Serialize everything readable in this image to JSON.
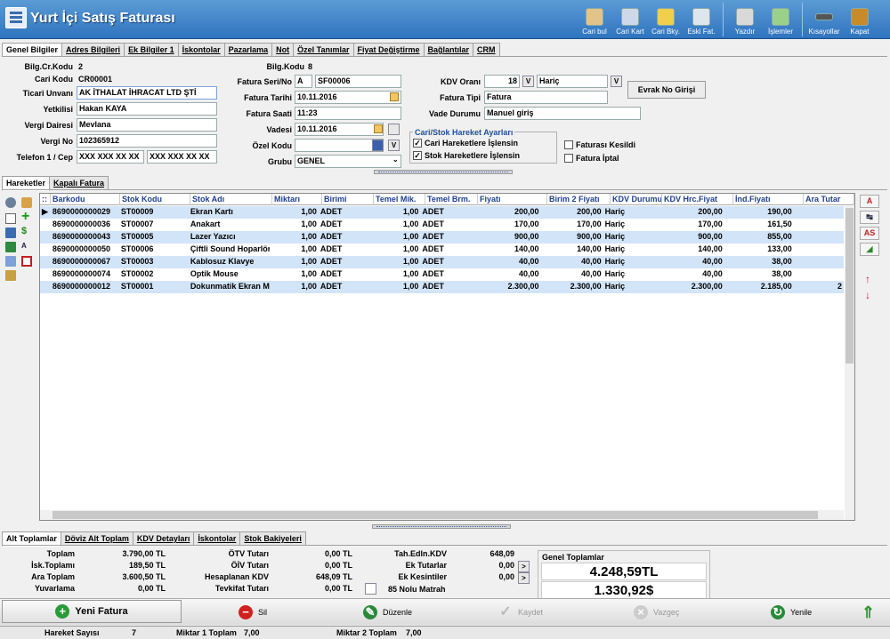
{
  "window": {
    "title": "Yurt İçi Satış Faturası"
  },
  "toolbar": [
    {
      "label": "Cari bul",
      "icon": "person-search-icon",
      "color": "#e2c48a"
    },
    {
      "label": "Cari Kart",
      "icon": "person-card-icon",
      "color": "#cfd8e8"
    },
    {
      "label": "Cari Bky.",
      "icon": "coins-icon",
      "color": "#f0cf4a"
    },
    {
      "label": "Eski Fat.",
      "icon": "document-stack-icon",
      "color": "#dde6ee"
    },
    {
      "label": "Yazdır",
      "icon": "printer-icon",
      "color": "#d9d9d9"
    },
    {
      "label": "İşlemler",
      "icon": "list-icon",
      "color": "#9ad18a"
    },
    {
      "label": "Kısayollar",
      "icon": "keyboard-icon",
      "color": "#555555"
    },
    {
      "label": "Kapat",
      "icon": "door-exit-icon",
      "color": "#c98a2a"
    }
  ],
  "top_tabs": [
    "Genel Bilgiler",
    "Adres Bilgileri",
    "Ek Bilgiler 1",
    "İskontolar",
    "Pazarlama",
    "Not",
    "Özel Tanımlar",
    "Fiyat Değiştirme",
    "Bağlantılar",
    "CRM"
  ],
  "form": {
    "bilg_cr_kodu_label": "Bilg.Cr.Kodu",
    "bilg_cr_kodu": "2",
    "cari_kodu_label": "Cari Kodu",
    "cari_kodu": "CR00001",
    "ticari_unvani_label": "Ticari Unvanı",
    "ticari_unvani": "AK İTHALAT İHRACAT LTD ŞTİ",
    "yetkilisi_label": "Yetkilisi",
    "yetkilisi": "Hakan KAYA",
    "vergi_dairesi_label": "Vergi Dairesi",
    "vergi_dairesi": "Mevlana",
    "vergi_no_label": "Vergi No",
    "vergi_no": "102365912",
    "telefon_label": "Telefon 1 / Cep",
    "telefon1": "XXX XXX XX XX",
    "cep": "XXX XXX XX XX",
    "bilg_kodu_label": "Bilg.Kodu",
    "bilg_kodu": "8",
    "fatura_seri_label": "Fatura Seri/No",
    "fatura_seri": "A",
    "fatura_no": "SF00006",
    "fatura_tarihi_label": "Fatura Tarihi",
    "fatura_tarihi": "10.11.2016",
    "fatura_saati_label": "Fatura Saati",
    "fatura_saati": "11:23",
    "vadesi_label": "Vadesi",
    "vadesi": "10.11.2016",
    "ozel_kodu_label": "Özel Kodu",
    "ozel_kodu": "",
    "grubu_label": "Grubu",
    "grubu": "GENEL",
    "kdv_orani_label": "KDV Oranı",
    "kdv_orani": "18",
    "kdv_v": "V",
    "kdv_tip": "Hariç",
    "kdv_tip_v": "V",
    "fatura_tipi_label": "Fatura Tipi",
    "fatura_tipi": "Fatura",
    "vade_durumu_label": "Vade Durumu",
    "vade_durumu": "Manuel giriş",
    "evrak_button": "Evrak No Girişi",
    "hareket_group_title": "Cari/Stok Hareket Ayarları",
    "cari_hareket_label": "Cari Hareketlere İşlensin",
    "cari_hareket_checked": true,
    "stok_hareket_label": "Stok Hareketlere İşlensin",
    "stok_hareket_checked": true,
    "faturasi_kesildi_label": "Faturası Kesildi",
    "faturasi_kesildi_checked": false,
    "fatura_iptal_label": "Fatura İptal",
    "fatura_iptal_checked": false,
    "ozel_v": "V"
  },
  "grid_tabs": [
    "Hareketler",
    "Kapalı Fatura"
  ],
  "grid": {
    "columns": [
      "Barkodu",
      "Stok Kodu",
      "Stok Adı",
      "Miktarı",
      "Birimi",
      "Temel Mik.",
      "Temel Brm.",
      "Fiyatı",
      "Birim 2 Fiyatı",
      "KDV Durumu",
      "KDV Hrc.Fiyat",
      "İnd.Fiyatı",
      "Ara Tutar"
    ],
    "rows": [
      [
        "8690000000029",
        "ST00009",
        "Ekran  Kartı",
        "1,00",
        "ADET",
        "1,00",
        "ADET",
        "200,00",
        "200,00",
        "Hariç",
        "200,00",
        "190,00",
        ""
      ],
      [
        "8690000000036",
        "ST00007",
        "Anakart",
        "1,00",
        "ADET",
        "1,00",
        "ADET",
        "170,00",
        "170,00",
        "Hariç",
        "170,00",
        "161,50",
        ""
      ],
      [
        "8690000000043",
        "ST00005",
        "Lazer Yazıcı",
        "1,00",
        "ADET",
        "1,00",
        "ADET",
        "900,00",
        "900,00",
        "Hariç",
        "900,00",
        "855,00",
        ""
      ],
      [
        "8690000000050",
        "ST00006",
        "Çiftli Sound Hoparlör",
        "1,00",
        "ADET",
        "1,00",
        "ADET",
        "140,00",
        "140,00",
        "Hariç",
        "140,00",
        "133,00",
        ""
      ],
      [
        "8690000000067",
        "ST00003",
        "Kablosuz Klavye",
        "1,00",
        "ADET",
        "1,00",
        "ADET",
        "40,00",
        "40,00",
        "Hariç",
        "40,00",
        "38,00",
        ""
      ],
      [
        "8690000000074",
        "ST00002",
        "Optik Mouse",
        "1,00",
        "ADET",
        "1,00",
        "ADET",
        "40,00",
        "40,00",
        "Hariç",
        "40,00",
        "38,00",
        ""
      ],
      [
        "8690000000012",
        "ST00001",
        "Dokunmatik Ekran Monitör",
        "1,00",
        "ADET",
        "1,00",
        "ADET",
        "2.300,00",
        "2.300,00",
        "Hariç",
        "2.300,00",
        "2.185,00",
        "2"
      ]
    ]
  },
  "right_buttons": [
    "A",
    "AS"
  ],
  "bottom_tabs": [
    "Alt Toplamlar",
    "Döviz Alt Toplam",
    "KDV Detayları",
    "İskontolar",
    "Stok Bakiyeleri"
  ],
  "totals": {
    "toplam_label": "Toplam",
    "toplam": "3.790,00 TL",
    "isk_label": "İsk.Toplamı",
    "isk": "189,50 TL",
    "ara_label": "Ara Toplam",
    "ara": "3.600,50 TL",
    "yuvarlama_label": "Yuvarlama",
    "yuvarlama": "0,00 TL",
    "otv_label": "ÖTV Tutarı",
    "otv": "0,00 TL",
    "oiv_label": "ÖİV Tutarı",
    "oiv": "0,00 TL",
    "hes_kdv_label": "Hesaplanan KDV",
    "hes_kdv": "648,09 TL",
    "tevkifat_label": "Tevkifat Tutarı",
    "tevkifat": "0,00 TL",
    "tah_label": "Tah.Edln.KDV",
    "tah": "648,09",
    "ek_tutar_label": "Ek Tutarlar",
    "ek_tutar": "0,00",
    "ek_kes_label": "Ek Kesintiler",
    "ek_kes": "0,00",
    "matrah_label": "85 Nolu Matrah",
    "genel_label": "Genel Toplamlar",
    "genel_tl": "4.248,59TL",
    "genel_usd": "1.330,92$",
    "more": ">"
  },
  "actions": {
    "new": "Yeni Fatura",
    "delete": "Sil",
    "edit": "Düzenle",
    "save": "Kaydet",
    "cancel": "Vazgeç",
    "refresh": "Yenile"
  },
  "status": {
    "hareket_label": "Hareket Sayısı",
    "hareket": "7",
    "miktar1_label": "Miktar 1 Toplam",
    "miktar1": "7,00",
    "miktar2_label": "Miktar 2 Toplam",
    "miktar2": "7,00"
  }
}
